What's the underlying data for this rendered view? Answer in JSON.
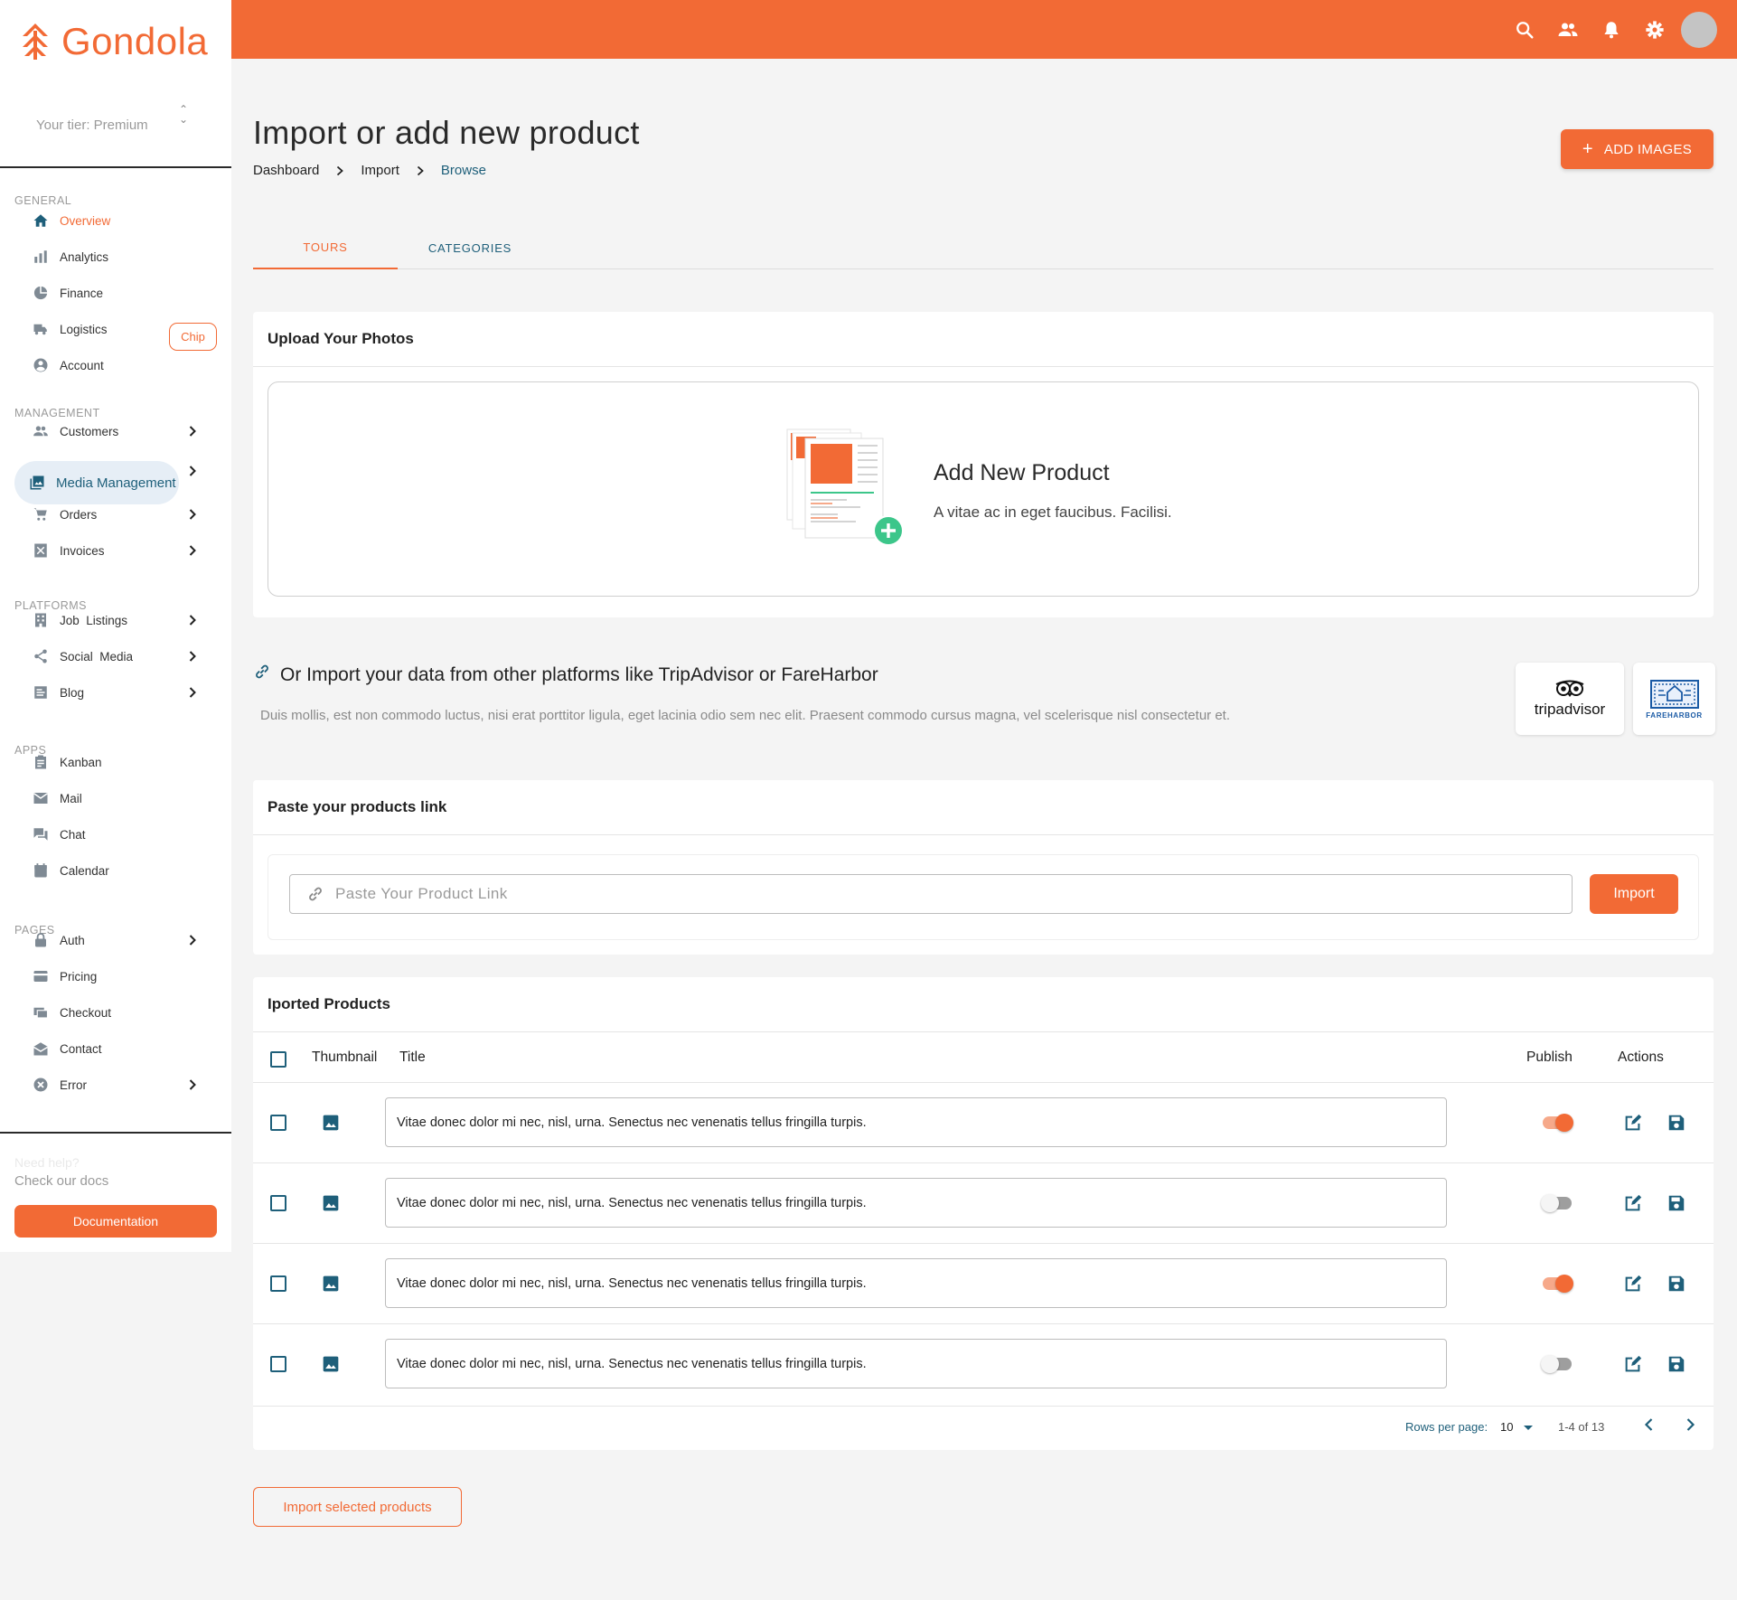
{
  "app": {
    "name": "Gondola",
    "tier_label": "Your tier: Premium"
  },
  "colors": {
    "brand": "#f26a35",
    "accent": "#1e5f7a",
    "background": "#f4f4f4"
  },
  "sidebar": {
    "sections": [
      {
        "label": "GENERAL",
        "items": [
          {
            "label": "Overview",
            "icon": "home-icon",
            "active": true
          },
          {
            "label": "Analytics",
            "icon": "bar-chart-icon"
          },
          {
            "label": "Finance",
            "icon": "pie-chart-icon"
          },
          {
            "label": "Logistics",
            "icon": "truck-icon",
            "chip": "Chip"
          },
          {
            "label": "Account",
            "icon": "account-circle-icon"
          }
        ]
      },
      {
        "label": "MANAGEMENT",
        "items": [
          {
            "label": "Customers",
            "icon": "people-icon",
            "expandable": true
          },
          {
            "label": "Media Management",
            "icon": "photo-library-icon",
            "expandable": true,
            "selected": true
          },
          {
            "label": "Orders",
            "icon": "cart-icon",
            "expandable": true
          },
          {
            "label": "Invoices",
            "icon": "invoice-icon",
            "expandable": true
          }
        ]
      },
      {
        "label": "PLATFORMS",
        "items": [
          {
            "label": "Job  Listings",
            "icon": "building-icon",
            "expandable": true
          },
          {
            "label": "Social  Media",
            "icon": "share-icon",
            "expandable": true
          },
          {
            "label": "Blog",
            "icon": "article-icon",
            "expandable": true
          }
        ]
      },
      {
        "label": "APPS",
        "items": [
          {
            "label": "Kanban",
            "icon": "clipboard-icon"
          },
          {
            "label": "Mail",
            "icon": "mail-icon"
          },
          {
            "label": "Chat",
            "icon": "chat-icon"
          },
          {
            "label": "Calendar",
            "icon": "calendar-icon"
          }
        ]
      },
      {
        "label": "PAGES",
        "items": [
          {
            "label": "Auth",
            "icon": "lock-icon",
            "expandable": true
          },
          {
            "label": "Pricing",
            "icon": "credit-card-icon"
          },
          {
            "label": "Checkout",
            "icon": "checkout-icon"
          },
          {
            "label": "Contact",
            "icon": "contact-mail-icon"
          },
          {
            "label": "Error",
            "icon": "error-icon",
            "expandable": true
          }
        ]
      }
    ],
    "help_title": "Need help?",
    "help_sub": "Check our docs",
    "doc_button": "Documentation"
  },
  "topbar": {
    "icons": [
      "search-icon",
      "people-icon",
      "bell-icon",
      "gear-icon",
      "avatar"
    ]
  },
  "header": {
    "title": "Import or add new product",
    "breadcrumb": [
      "Dashboard",
      "Import",
      "Browse"
    ],
    "add_images_label": "ADD IMAGES"
  },
  "tabs": [
    "TOURS",
    "CATEGORIES"
  ],
  "upload": {
    "title": "Upload Your Photos",
    "dz_title": "Add New Product",
    "dz_sub": "A vitae ac in eget faucibus. Facilisi."
  },
  "import_platforms": {
    "heading": "Or Import your data from other platforms like TripAdvisor or FareHarbor",
    "description": "Duis mollis, est non commodo luctus, nisi erat porttitor ligula, eget lacinia odio sem nec elit. Praesent commodo cursus magna, vel scelerisque nisl consectetur et.",
    "tripadvisor": "tripadvisor",
    "fareharbor": "FAREHARBOR"
  },
  "paste": {
    "title": "Paste your products link",
    "placeholder": "Paste Your Product Link",
    "button": "Import"
  },
  "table": {
    "title": "Iported Products",
    "columns": [
      "Thumbnail",
      "Title",
      "Publish",
      "Actions"
    ],
    "rows": [
      {
        "title": "Vitae donec dolor mi nec, nisl, urna. Senectus nec venenatis tellus fringilla turpis.",
        "publish": true
      },
      {
        "title": "Vitae donec dolor mi nec, nisl, urna. Senectus nec venenatis tellus fringilla turpis.",
        "publish": false
      },
      {
        "title": "Vitae donec dolor mi nec, nisl, urna. Senectus nec venenatis tellus fringilla turpis.",
        "publish": true
      },
      {
        "title": "Vitae donec dolor mi nec, nisl, urna. Senectus nec venenatis tellus fringilla turpis.",
        "publish": false
      }
    ],
    "rows_per_page_label": "Rows per page:",
    "rows_per_page": "10",
    "range": "1-4 of 13"
  },
  "footer_button": "Import selected products"
}
